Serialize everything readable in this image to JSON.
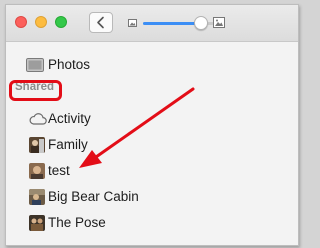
{
  "window": {
    "controls": [
      "close",
      "minimize",
      "zoom"
    ],
    "back_icon": "chevron-left-icon",
    "zoom_slider_value": 0.85
  },
  "sidebar": {
    "top_item": {
      "label": "Photos",
      "icon": "photos-icon"
    },
    "section_header": "Shared",
    "items": [
      {
        "label": "Activity",
        "icon": "cloud-icon"
      },
      {
        "label": "Family",
        "icon": "album-thumbnail"
      },
      {
        "label": "test",
        "icon": "album-thumbnail"
      },
      {
        "label": "Big Bear Cabin",
        "icon": "album-thumbnail"
      },
      {
        "label": "The Pose",
        "icon": "album-thumbnail"
      }
    ]
  },
  "annotation": {
    "highlight_color": "#e30d17",
    "arrow_color": "#e30d17"
  }
}
